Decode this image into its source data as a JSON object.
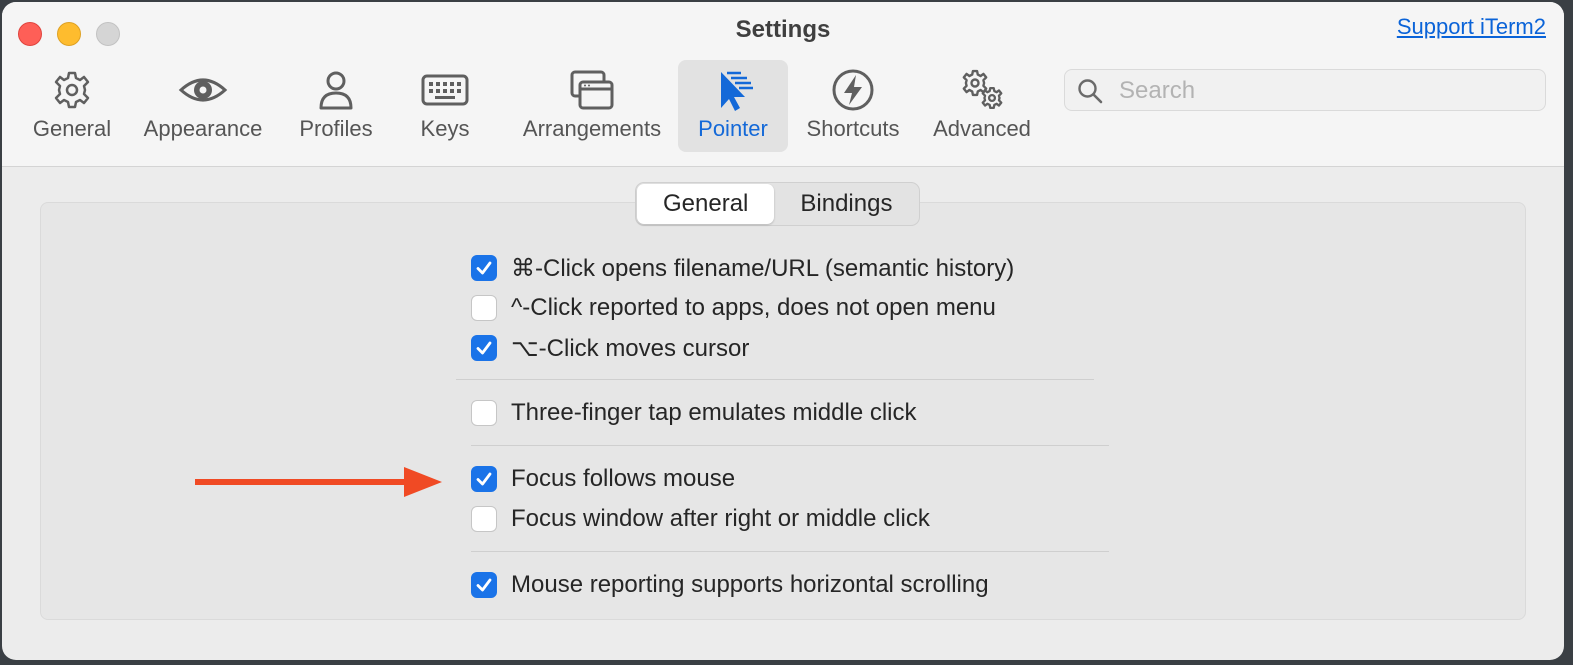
{
  "window": {
    "title": "Settings",
    "support_link": "Support iTerm2"
  },
  "toolbar": {
    "items": [
      {
        "label": "General",
        "icon": "gear-icon"
      },
      {
        "label": "Appearance",
        "icon": "eye-icon"
      },
      {
        "label": "Profiles",
        "icon": "person-icon"
      },
      {
        "label": "Keys",
        "icon": "keyboard-icon"
      },
      {
        "label": "Arrangements",
        "icon": "windows-icon"
      },
      {
        "label": "Pointer",
        "icon": "pointer-icon",
        "selected": true
      },
      {
        "label": "Shortcuts",
        "icon": "bolt-icon"
      },
      {
        "label": "Advanced",
        "icon": "gears-icon"
      }
    ],
    "search_placeholder": "Search"
  },
  "tabs": [
    {
      "label": "General",
      "selected": true
    },
    {
      "label": "Bindings",
      "selected": false
    }
  ],
  "options": [
    {
      "label": "⌘-Click opens filename/URL (semantic history)",
      "checked": true
    },
    {
      "label": "^-Click reported to apps, does not open menu",
      "checked": false
    },
    {
      "label": "⌥-Click moves cursor",
      "checked": true
    },
    {
      "label": "Three-finger tap emulates middle click",
      "checked": false
    },
    {
      "label": "Focus follows mouse",
      "checked": true
    },
    {
      "label": "Focus window after right or middle click",
      "checked": false
    },
    {
      "label": "Mouse reporting supports horizontal scrolling",
      "checked": true
    }
  ],
  "colors": {
    "accent": "#1a73e8",
    "annotation_arrow": "#f04a24",
    "selected_tab_text": "#1469d8"
  }
}
